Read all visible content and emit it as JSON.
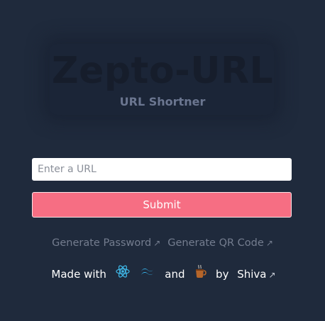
{
  "header": {
    "title": "Zepto-URL",
    "subtitle": "URL Shortner"
  },
  "form": {
    "url_placeholder": "Enter a URL",
    "url_value": "",
    "submit_label": "Submit"
  },
  "links": {
    "generate_password": "Generate Password",
    "generate_qr": "Generate QR Code",
    "external_glyph": "↗"
  },
  "footer": {
    "made_with": "Made with",
    "and": "and",
    "by": "by",
    "author": "Shiva",
    "external_glyph": "↗",
    "icons": [
      "react-icon",
      "tailwind-icon",
      "coffee-icon"
    ]
  },
  "colors": {
    "background": "#1f2a3c",
    "submit": "#f66e83",
    "react": "#3fb8e8",
    "tailwind": "#38bdf8",
    "coffee": "#b5652a"
  }
}
